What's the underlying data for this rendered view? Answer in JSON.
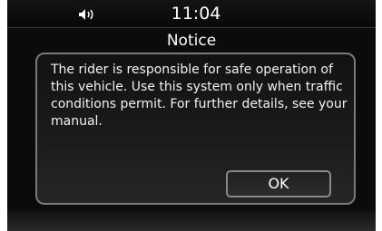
{
  "status_bar": {
    "time": "11:04",
    "volume_icon": "speaker-volume-icon"
  },
  "dialog": {
    "title": "Notice",
    "message": "The rider is responsible for safe operation of this vehicle. Use this system only when traffic conditions permit. For further details, see your manual.",
    "ok_label": "OK"
  },
  "colors": {
    "background": "#0b0b0b",
    "border": "#7a7a7a",
    "text": "#ffffff"
  }
}
